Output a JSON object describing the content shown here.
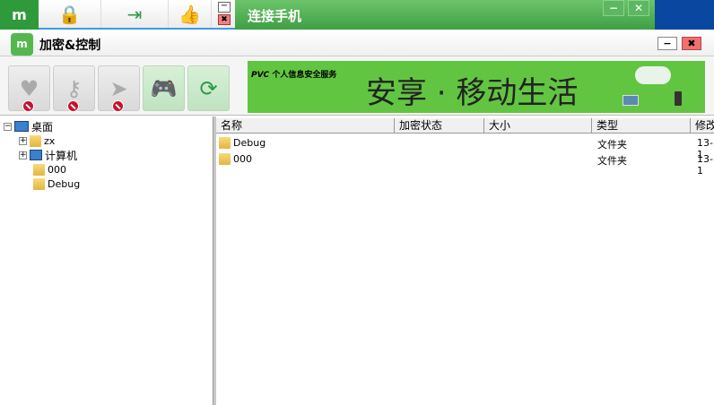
{
  "topbar": {
    "title": "连接手机",
    "tabs": [
      "lock-tab",
      "transfer-tab",
      "like-tab"
    ]
  },
  "app": {
    "title": "加密&控制",
    "logo": "m"
  },
  "toolbar": {
    "buttons": [
      {
        "name": "lock",
        "icon": "♥",
        "disabled": true
      },
      {
        "name": "key",
        "icon": "⚷",
        "disabled": true
      },
      {
        "name": "send",
        "icon": "➤",
        "disabled": true
      },
      {
        "name": "gamepad",
        "icon": "🎮",
        "disabled": false
      },
      {
        "name": "sync",
        "icon": "⟳",
        "disabled": false
      }
    ]
  },
  "banner": {
    "brand": "PVC",
    "tagline": "个人信息安全服务",
    "slogan": "安享 · 移动生活"
  },
  "tree": {
    "root": "桌面",
    "children": [
      {
        "label": "zx",
        "expandable": true
      },
      {
        "label": "计算机",
        "expandable": true
      },
      {
        "label": "000",
        "expandable": false
      },
      {
        "label": "Debug",
        "expandable": false
      }
    ]
  },
  "list": {
    "columns": [
      "名称",
      "加密状态",
      "大小",
      "类型",
      "修改"
    ],
    "rows": [
      {
        "name": "Debug",
        "status": "",
        "size": "",
        "type": "文件夹",
        "modified": "13-1"
      },
      {
        "name": "000",
        "status": "",
        "size": "",
        "type": "文件夹",
        "modified": "13-1"
      }
    ]
  }
}
